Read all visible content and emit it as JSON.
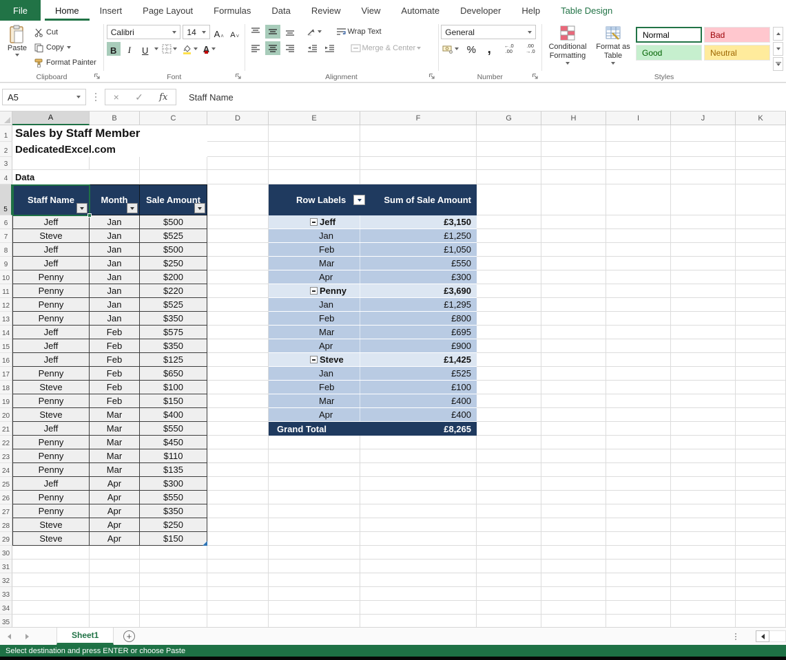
{
  "ribbon": {
    "tabs": [
      {
        "label": "File",
        "type": "file"
      },
      {
        "label": "Home",
        "type": "active"
      },
      {
        "label": "Insert",
        "type": "normal"
      },
      {
        "label": "Page Layout",
        "type": "normal"
      },
      {
        "label": "Formulas",
        "type": "normal"
      },
      {
        "label": "Data",
        "type": "normal"
      },
      {
        "label": "Review",
        "type": "normal"
      },
      {
        "label": "View",
        "type": "normal"
      },
      {
        "label": "Automate",
        "type": "normal"
      },
      {
        "label": "Developer",
        "type": "normal"
      },
      {
        "label": "Help",
        "type": "normal"
      },
      {
        "label": "Table Design",
        "type": "contextual"
      }
    ],
    "clipboard": {
      "group_label": "Clipboard",
      "paste": "Paste",
      "cut": "Cut",
      "copy": "Copy",
      "format_painter": "Format Painter"
    },
    "font": {
      "group_label": "Font",
      "font_name": "Calibri",
      "font_size": "14"
    },
    "alignment": {
      "group_label": "Alignment",
      "wrap_text": "Wrap Text",
      "merge_center": "Merge & Center"
    },
    "number": {
      "group_label": "Number",
      "format": "General"
    },
    "styles": {
      "group_label": "Styles",
      "conditional_formatting": "Conditional Formatting",
      "format_as_table": "Format as Table",
      "gallery": [
        {
          "key": "normal",
          "label": "Normal"
        },
        {
          "key": "bad",
          "label": "Bad"
        },
        {
          "key": "good",
          "label": "Good"
        },
        {
          "key": "neutral",
          "label": "Neutral"
        }
      ]
    }
  },
  "icons": {
    "bold": "B",
    "italic": "I",
    "underline": "U",
    "letter_a": "A",
    "percent": "%",
    "comma": ",",
    "cancel": "×",
    "enter": "✓",
    "fx": "fx",
    "increase_decimal_top": "←.0",
    "increase_decimal_bottom": ".00",
    "decrease_decimal_top": ".00",
    "decrease_decimal_bottom": "→.0",
    "add_sheet": "+"
  },
  "formula_bar": {
    "name_box": "A5",
    "formula": "Staff Name"
  },
  "grid": {
    "column_headers": [
      "A",
      "B",
      "C",
      "D",
      "E",
      "F",
      "G",
      "H",
      "I",
      "J",
      "K"
    ],
    "row_count": 35,
    "selected_column": "A",
    "selected_row": 5
  },
  "cells": [
    {
      "ref": "A1",
      "row": 1,
      "text": "Sales by Staff Member",
      "style": "title"
    },
    {
      "ref": "A2",
      "row": 2,
      "text": "DedicatedExcel.com",
      "style": "subtitle"
    },
    {
      "ref": "A4",
      "row": 4,
      "text": "Data",
      "style": "label"
    }
  ],
  "data_table": {
    "headers": [
      "Staff Name",
      "Month",
      "Sale Amount"
    ],
    "rows": [
      [
        "Jeff",
        "Jan",
        "$500"
      ],
      [
        "Steve",
        "Jan",
        "$525"
      ],
      [
        "Jeff",
        "Jan",
        "$500"
      ],
      [
        "Jeff",
        "Jan",
        "$250"
      ],
      [
        "Penny",
        "Jan",
        "$200"
      ],
      [
        "Penny",
        "Jan",
        "$220"
      ],
      [
        "Penny",
        "Jan",
        "$525"
      ],
      [
        "Penny",
        "Jan",
        "$350"
      ],
      [
        "Jeff",
        "Feb",
        "$575"
      ],
      [
        "Jeff",
        "Feb",
        "$350"
      ],
      [
        "Jeff",
        "Feb",
        "$125"
      ],
      [
        "Penny",
        "Feb",
        "$650"
      ],
      [
        "Steve",
        "Feb",
        "$100"
      ],
      [
        "Penny",
        "Feb",
        "$150"
      ],
      [
        "Steve",
        "Mar",
        "$400"
      ],
      [
        "Jeff",
        "Mar",
        "$550"
      ],
      [
        "Penny",
        "Mar",
        "$450"
      ],
      [
        "Penny",
        "Mar",
        "$110"
      ],
      [
        "Penny",
        "Mar",
        "$135"
      ],
      [
        "Jeff",
        "Apr",
        "$300"
      ],
      [
        "Penny",
        "Apr",
        "$550"
      ],
      [
        "Penny",
        "Apr",
        "$350"
      ],
      [
        "Steve",
        "Apr",
        "$250"
      ],
      [
        "Steve",
        "Apr",
        "$150"
      ]
    ]
  },
  "pivot_table": {
    "row_label_header": "Row Labels",
    "value_header": "Sum of Sale Amount",
    "rows": [
      {
        "label": "Jeff",
        "value": "£3,150",
        "type": "parent"
      },
      {
        "label": "Jan",
        "value": "£1,250",
        "type": "child"
      },
      {
        "label": "Feb",
        "value": "£1,050",
        "type": "child"
      },
      {
        "label": "Mar",
        "value": "£550",
        "type": "child"
      },
      {
        "label": "Apr",
        "value": "£300",
        "type": "child"
      },
      {
        "label": "Penny",
        "value": "£3,690",
        "type": "parent"
      },
      {
        "label": "Jan",
        "value": "£1,295",
        "type": "child"
      },
      {
        "label": "Feb",
        "value": "£800",
        "type": "child"
      },
      {
        "label": "Mar",
        "value": "£695",
        "type": "child"
      },
      {
        "label": "Apr",
        "value": "£900",
        "type": "child"
      },
      {
        "label": "Steve",
        "value": "£1,425",
        "type": "parent"
      },
      {
        "label": "Jan",
        "value": "£525",
        "type": "child"
      },
      {
        "label": "Feb",
        "value": "£100",
        "type": "child"
      },
      {
        "label": "Mar",
        "value": "£400",
        "type": "child"
      },
      {
        "label": "Apr",
        "value": "£400",
        "type": "child"
      },
      {
        "label": "Grand Total",
        "value": "£8,265",
        "type": "grand"
      }
    ]
  },
  "sheet_bar": {
    "active_tab": "Sheet1"
  },
  "status_bar": {
    "message": "Select destination and press ENTER or choose Paste"
  },
  "colors": {
    "excel_green": "#217346",
    "selection_green": "#1E7145",
    "table_header_navy": "#1F3A5F",
    "pivot_child_blue": "#B9CBE3",
    "pivot_parent_blue": "#DCE6F2",
    "style_bad_bg": "#FFC7CE",
    "style_good_bg": "#C6EFCE",
    "style_neutral_bg": "#FFEB9C"
  }
}
